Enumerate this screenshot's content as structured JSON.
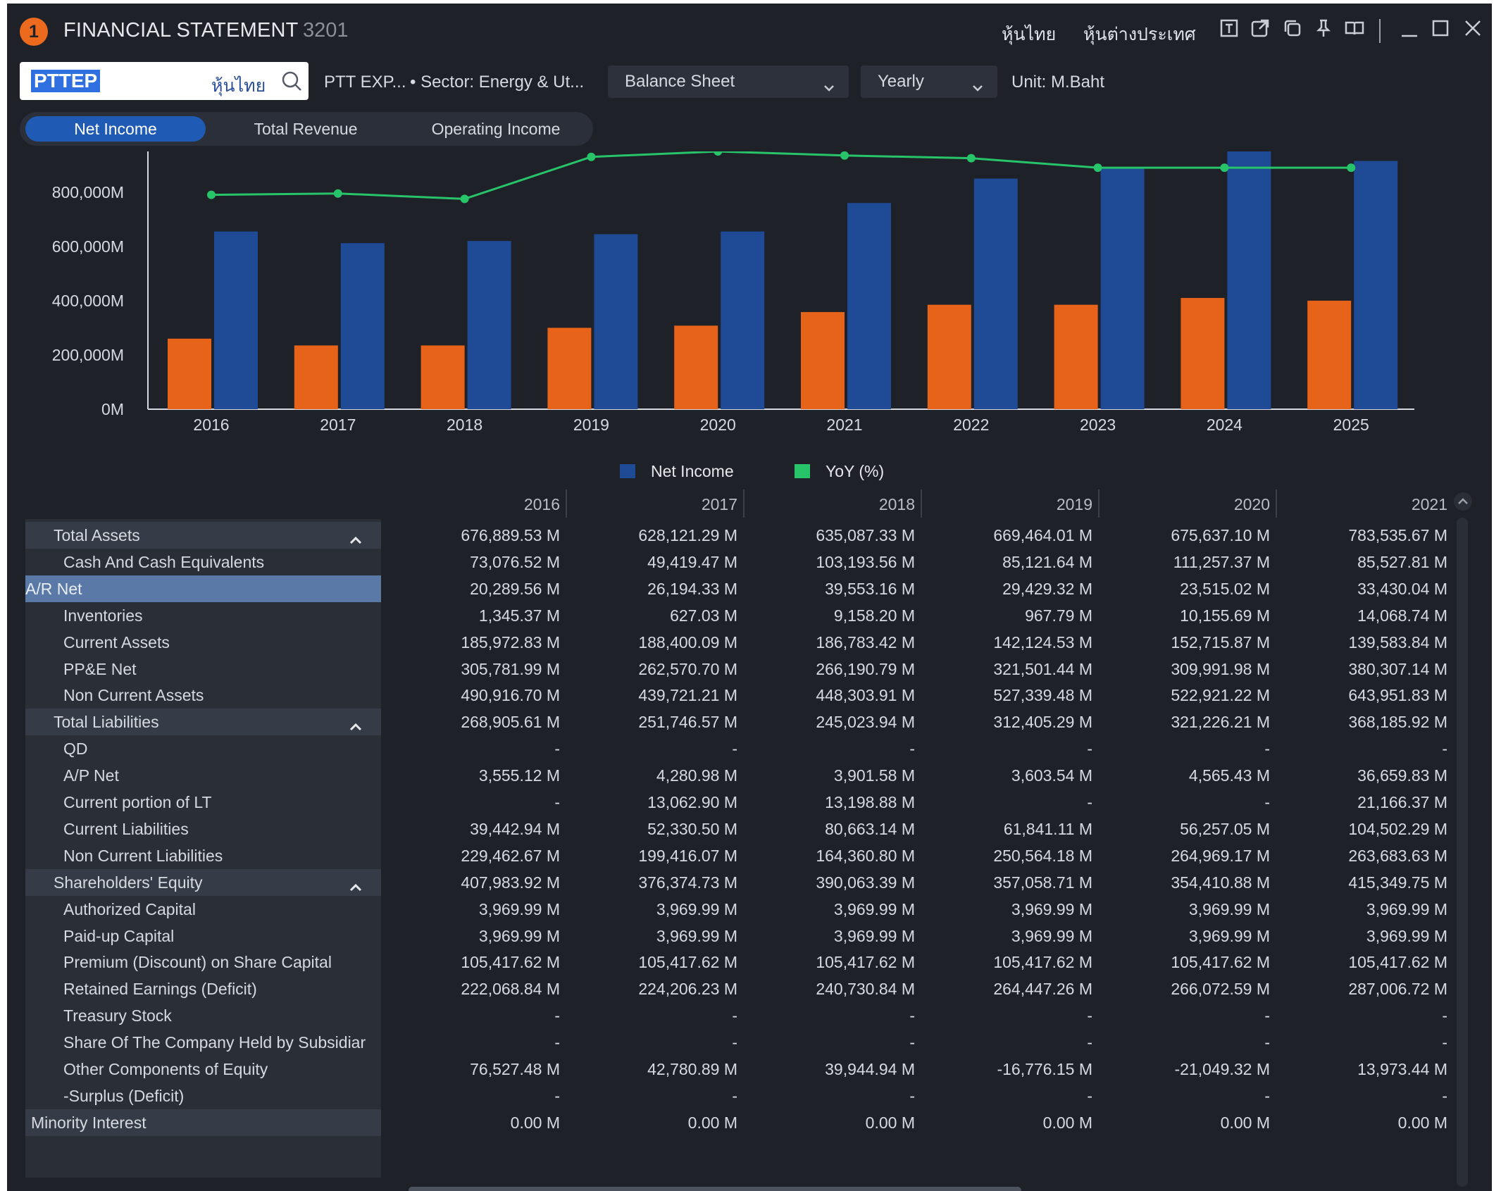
{
  "window": {
    "badge": "1",
    "title": "FINANCIAL STATEMENT",
    "code": "3201",
    "links": [
      "หุ้นไทย",
      "หุ้นต่างประเทศ"
    ],
    "icons": [
      "text-icon",
      "external-link-icon",
      "copy-icon",
      "pin-icon",
      "book-icon",
      "minimize-icon",
      "maximize-icon",
      "close-icon"
    ]
  },
  "toolbar": {
    "symbol": "PTTEP",
    "market": "หุ้นไทย",
    "stock_name": "PTT EXP...",
    "sector": "• Sector: Energy & Ut...",
    "statement": "Balance Sheet",
    "period": "Yearly",
    "unit": "Unit: M.Baht"
  },
  "tabs": [
    {
      "label": "Net Income",
      "active": true
    },
    {
      "label": "Total Revenue",
      "active": false
    },
    {
      "label": "Operating Income",
      "active": false
    }
  ],
  "chart_data": {
    "type": "bar",
    "categories": [
      "2016",
      "2017",
      "2018",
      "2019",
      "2020",
      "2021",
      "2022",
      "2023",
      "2024",
      "2025"
    ],
    "series": [
      {
        "name": "",
        "color": "#e8631a",
        "values": [
          260000,
          235000,
          235000,
          300000,
          308000,
          358000,
          385000,
          385000,
          410000,
          400000
        ]
      },
      {
        "name": "Net Income",
        "color": "#1f4a96",
        "values": [
          655000,
          612000,
          620000,
          645000,
          655000,
          760000,
          850000,
          890000,
          950000,
          915000
        ]
      }
    ],
    "line": {
      "name": "YoY (%)",
      "color": "#27c46a",
      "values": [
        790000,
        795000,
        775000,
        930000,
        950000,
        935000,
        925000,
        890000,
        890000,
        890000
      ]
    },
    "y_ticks": [
      "0M",
      "200,000M",
      "400,000M",
      "600,000M",
      "800,000M"
    ],
    "ylim": [
      0,
      950000
    ],
    "legend": [
      "Net Income",
      "YoY (%)"
    ],
    "legend_colors": [
      "#1f4a96",
      "#27c46a"
    ],
    "legend_position": "bottom-center"
  },
  "table": {
    "years": [
      "2016",
      "2017",
      "2018",
      "2019",
      "2020",
      "2021"
    ],
    "rows": [
      {
        "label": "Total Assets",
        "kind": "group",
        "values": [
          "676,889.53 M",
          "628,121.29 M",
          "635,087.33 M",
          "669,464.01 M",
          "675,637.10 M",
          "783,535.67 M"
        ]
      },
      {
        "label": "Cash And Cash Equivalents",
        "kind": "child",
        "values": [
          "73,076.52 M",
          "49,419.47 M",
          "103,193.56 M",
          "85,121.64 M",
          "111,257.37 M",
          "85,527.81 M"
        ]
      },
      {
        "label": "A/R Net",
        "kind": "selected",
        "values": [
          "20,289.56 M",
          "26,194.33 M",
          "39,553.16 M",
          "29,429.32 M",
          "23,515.02 M",
          "33,430.04 M"
        ]
      },
      {
        "label": "Inventories",
        "kind": "child",
        "values": [
          "1,345.37 M",
          "627.03 M",
          "9,158.20 M",
          "967.79 M",
          "10,155.69 M",
          "14,068.74 M"
        ]
      },
      {
        "label": "Current Assets",
        "kind": "child",
        "values": [
          "185,972.83 M",
          "188,400.09 M",
          "186,783.42 M",
          "142,124.53 M",
          "152,715.87 M",
          "139,583.84 M"
        ]
      },
      {
        "label": "PP&E Net",
        "kind": "child",
        "values": [
          "305,781.99 M",
          "262,570.70 M",
          "266,190.79 M",
          "321,501.44 M",
          "309,991.98 M",
          "380,307.14 M"
        ]
      },
      {
        "label": "Non Current Assets",
        "kind": "child",
        "values": [
          "490,916.70 M",
          "439,721.21 M",
          "448,303.91 M",
          "527,339.48 M",
          "522,921.22 M",
          "643,951.83 M"
        ]
      },
      {
        "label": "Total Liabilities",
        "kind": "group",
        "values": [
          "268,905.61 M",
          "251,746.57 M",
          "245,023.94 M",
          "312,405.29 M",
          "321,226.21 M",
          "368,185.92 M"
        ]
      },
      {
        "label": "QD",
        "kind": "child",
        "values": [
          "-",
          "-",
          "-",
          "-",
          "-",
          "-"
        ]
      },
      {
        "label": "A/P Net",
        "kind": "child",
        "values": [
          "3,555.12 M",
          "4,280.98 M",
          "3,901.58 M",
          "3,603.54 M",
          "4,565.43 M",
          "36,659.83 M"
        ]
      },
      {
        "label": "Current portion of LT",
        "kind": "child",
        "values": [
          "-",
          "13,062.90 M",
          "13,198.88 M",
          "-",
          "-",
          "21,166.37 M"
        ]
      },
      {
        "label": "Current Liabilities",
        "kind": "child",
        "values": [
          "39,442.94 M",
          "52,330.50 M",
          "80,663.14 M",
          "61,841.11 M",
          "56,257.05 M",
          "104,502.29 M"
        ]
      },
      {
        "label": "Non Current Liabilities",
        "kind": "child",
        "values": [
          "229,462.67 M",
          "199,416.07 M",
          "164,360.80 M",
          "250,564.18 M",
          "264,969.17 M",
          "263,683.63 M"
        ]
      },
      {
        "label": "Shareholders' Equity",
        "kind": "group",
        "values": [
          "407,983.92 M",
          "376,374.73 M",
          "390,063.39 M",
          "357,058.71 M",
          "354,410.88 M",
          "415,349.75 M"
        ]
      },
      {
        "label": "Authorized Capital",
        "kind": "child",
        "values": [
          "3,969.99 M",
          "3,969.99 M",
          "3,969.99 M",
          "3,969.99 M",
          "3,969.99 M",
          "3,969.99 M"
        ]
      },
      {
        "label": "Paid-up Capital",
        "kind": "child",
        "values": [
          "3,969.99 M",
          "3,969.99 M",
          "3,969.99 M",
          "3,969.99 M",
          "3,969.99 M",
          "3,969.99 M"
        ]
      },
      {
        "label": "Premium (Discount) on Share Capital",
        "kind": "child",
        "values": [
          "105,417.62 M",
          "105,417.62 M",
          "105,417.62 M",
          "105,417.62 M",
          "105,417.62 M",
          "105,417.62 M"
        ]
      },
      {
        "label": "Retained Earnings (Deficit)",
        "kind": "child",
        "values": [
          "222,068.84 M",
          "224,206.23 M",
          "240,730.84 M",
          "264,447.26 M",
          "266,072.59 M",
          "287,006.72 M"
        ]
      },
      {
        "label": "Treasury Stock",
        "kind": "child",
        "values": [
          "-",
          "-",
          "-",
          "-",
          "-",
          "-"
        ]
      },
      {
        "label": "Share Of The Company Held by Subsidiar",
        "kind": "child",
        "values": [
          "-",
          "-",
          "-",
          "-",
          "-",
          "-"
        ]
      },
      {
        "label": "Other Components of Equity",
        "kind": "child",
        "values": [
          "76,527.48 M",
          "42,780.89 M",
          "39,944.94 M",
          "-16,776.15 M",
          "-21,049.32 M",
          "13,973.44 M"
        ]
      },
      {
        "label": "-Surplus (Deficit)",
        "kind": "child",
        "values": [
          "-",
          "-",
          "-",
          "-",
          "-",
          "-"
        ]
      },
      {
        "label": "Minority Interest",
        "kind": "minority",
        "values": [
          "0.00 M",
          "0.00 M",
          "0.00 M",
          "0.00 M",
          "0.00 M",
          "0.00 M"
        ]
      }
    ]
  }
}
